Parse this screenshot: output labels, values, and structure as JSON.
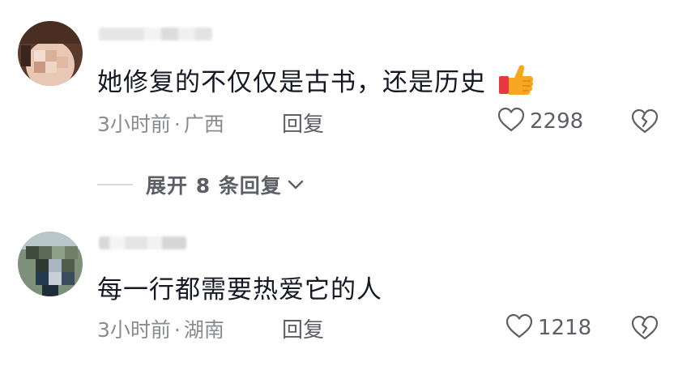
{
  "comments": [
    {
      "text": "她修复的不仅仅是古书，还是历史",
      "time": "3小时前",
      "separator": "·",
      "location": "广西",
      "reply_label": "回复",
      "like_count": "2298",
      "emoji": "thumbs-up-icon",
      "expand_label": "展开 8 条回复"
    },
    {
      "text": "每一行都需要热爱它的人",
      "time": "3小时前",
      "separator": "·",
      "location": "湖南",
      "reply_label": "回复",
      "like_count": "1218"
    }
  ],
  "colors": {
    "text_primary": "#161823",
    "text_meta": "#8a8b91",
    "text_action": "#5e5f66",
    "divider": "#d9d9dc",
    "thumb": "#f5a623",
    "cuff": "#e8383d"
  }
}
